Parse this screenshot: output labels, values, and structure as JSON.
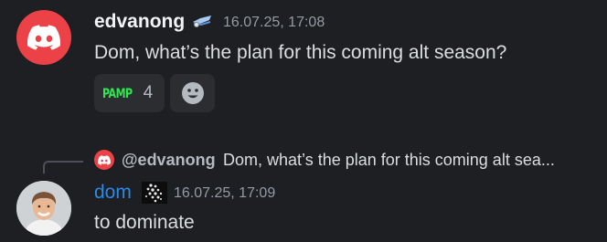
{
  "messages": [
    {
      "author": "edvanong",
      "author_icon": "discord-logo-icon",
      "badge_icon": "tag-badge-icon",
      "timestamp": "16.07.25, 17:08",
      "content": "Dom, what’s the plan for this coming alt season?",
      "reactions": [
        {
          "emoji_text": "PAMP",
          "count": "4"
        }
      ],
      "add_reaction_icon": "add-reaction-smiley-icon"
    },
    {
      "reply_to": {
        "author": "@edvanong",
        "preview": "Dom, what’s the plan for this coming alt sea..."
      },
      "author": "dom",
      "avatar_icon": "user-avatar-photo",
      "badge_icon": "iota-logo-icon",
      "timestamp": "16.07.25, 17:09",
      "content": "to dominate"
    }
  ],
  "colors": {
    "background": "#1e1f22",
    "discord_red": "#ec4147",
    "username_blue": "#2e89e6",
    "pamp_green": "#2ee84f",
    "muted": "#949ba4"
  }
}
